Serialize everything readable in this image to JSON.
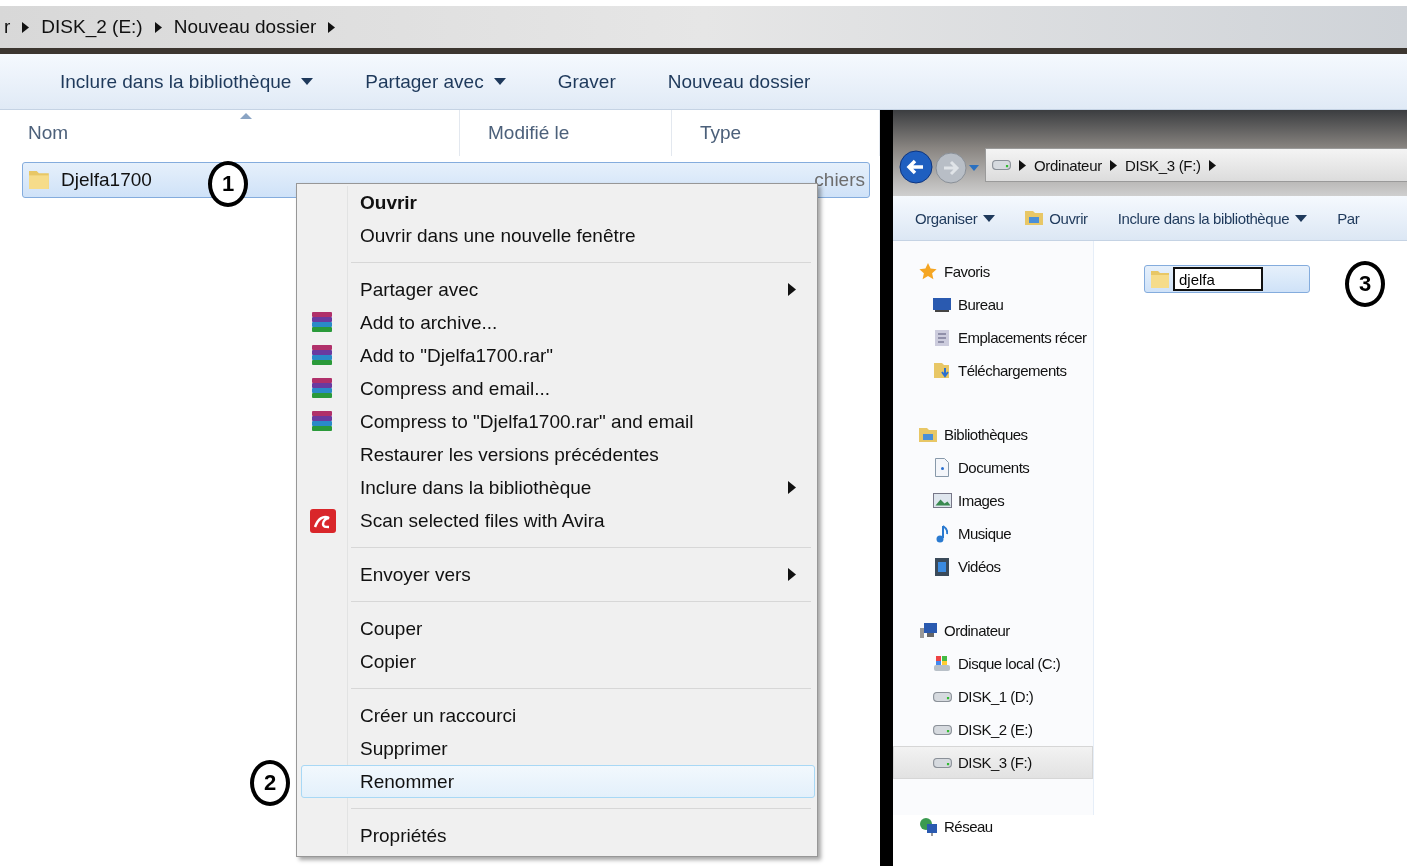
{
  "left_window": {
    "breadcrumb": [
      "r",
      "DISK_2 (E:)",
      "Nouveau dossier"
    ],
    "toolbar": [
      {
        "label": "Inclure dans la bibliothèque",
        "dropdown": true
      },
      {
        "label": "Partager avec",
        "dropdown": true
      },
      {
        "label": "Graver",
        "dropdown": false
      },
      {
        "label": "Nouveau dossier",
        "dropdown": false
      }
    ],
    "columns": [
      "Nom",
      "Modifié le",
      "Type"
    ],
    "rows": [
      {
        "name": "Djelfa1700",
        "type": "chiers",
        "selected": true
      }
    ]
  },
  "context_menu": {
    "items": [
      {
        "kind": "plain",
        "label": "Ouvrir",
        "default": true,
        "submenu": false,
        "highlighted": false
      },
      {
        "kind": "plain",
        "label": "Ouvrir dans une nouvelle fenêtre",
        "default": false,
        "submenu": false,
        "highlighted": false
      },
      {
        "kind": "separator"
      },
      {
        "kind": "plain",
        "label": "Partager avec",
        "default": false,
        "submenu": true,
        "highlighted": false
      },
      {
        "kind": "archive",
        "label": "Add to archive...",
        "default": false,
        "submenu": false,
        "highlighted": false
      },
      {
        "kind": "archive",
        "label": "Add to \"Djelfa1700.rar\"",
        "default": false,
        "submenu": false,
        "highlighted": false
      },
      {
        "kind": "archive",
        "label": "Compress and email...",
        "default": false,
        "submenu": false,
        "highlighted": false
      },
      {
        "kind": "archive",
        "label": "Compress to \"Djelfa1700.rar\" and email",
        "default": false,
        "submenu": false,
        "highlighted": false
      },
      {
        "kind": "plain",
        "label": "Restaurer les versions précédentes",
        "default": false,
        "submenu": false,
        "highlighted": false
      },
      {
        "kind": "plain",
        "label": "Inclure dans la bibliothèque",
        "default": false,
        "submenu": true,
        "highlighted": false
      },
      {
        "kind": "antivirus",
        "label": "Scan selected files with Avira",
        "default": false,
        "submenu": false,
        "highlighted": false
      },
      {
        "kind": "separator"
      },
      {
        "kind": "plain",
        "label": "Envoyer vers",
        "default": false,
        "submenu": true,
        "highlighted": false
      },
      {
        "kind": "separator"
      },
      {
        "kind": "plain",
        "label": "Couper",
        "default": false,
        "submenu": false,
        "highlighted": false
      },
      {
        "kind": "plain",
        "label": "Copier",
        "default": false,
        "submenu": false,
        "highlighted": false
      },
      {
        "kind": "separator"
      },
      {
        "kind": "plain",
        "label": "Créer un raccourci",
        "default": false,
        "submenu": false,
        "highlighted": false
      },
      {
        "kind": "plain",
        "label": "Supprimer",
        "default": false,
        "submenu": false,
        "highlighted": false
      },
      {
        "kind": "plain",
        "label": "Renommer",
        "default": false,
        "submenu": false,
        "highlighted": true
      },
      {
        "kind": "separator"
      },
      {
        "kind": "plain",
        "label": "Propriétés",
        "default": false,
        "submenu": false,
        "highlighted": false
      }
    ]
  },
  "annotations": [
    "1",
    "2",
    "3"
  ],
  "right_window": {
    "breadcrumb": [
      "Ordinateur",
      "DISK_3 (F:)"
    ],
    "toolbar": [
      {
        "label": "Organiser",
        "dropdown": true
      },
      {
        "label": "Ouvrir",
        "dropdown": false
      },
      {
        "label": "Inclure dans la bibliothèque",
        "dropdown": true
      },
      {
        "label": "Par",
        "dropdown": false
      }
    ],
    "nav": [
      {
        "kind": "star",
        "label": "Favoris",
        "selected": false,
        "children": [
          {
            "kind": "desktop",
            "label": "Bureau",
            "selected": false
          },
          {
            "kind": "recent",
            "label": "Emplacements récer",
            "selected": false
          },
          {
            "kind": "download",
            "label": "Téléchargements",
            "selected": false
          }
        ]
      },
      {
        "kind": "library",
        "label": "Bibliothèques",
        "selected": false,
        "children": [
          {
            "kind": "document",
            "label": "Documents",
            "selected": false
          },
          {
            "kind": "image",
            "label": "Images",
            "selected": false
          },
          {
            "kind": "music",
            "label": "Musique",
            "selected": false
          },
          {
            "kind": "video",
            "label": "Vidéos",
            "selected": false
          }
        ]
      },
      {
        "kind": "computer",
        "label": "Ordinateur",
        "selected": false,
        "children": [
          {
            "kind": "system-drive",
            "label": "Disque local (C:)",
            "selected": false
          },
          {
            "kind": "drive",
            "label": "DISK_1 (D:)",
            "selected": false
          },
          {
            "kind": "drive",
            "label": "DISK_2 (E:)",
            "selected": false
          },
          {
            "kind": "drive",
            "label": "DISK_3 (F:)",
            "selected": true
          }
        ]
      },
      {
        "kind": "network",
        "label": "Réseau",
        "selected": false
      }
    ],
    "rename": {
      "value": "djelfa"
    }
  }
}
